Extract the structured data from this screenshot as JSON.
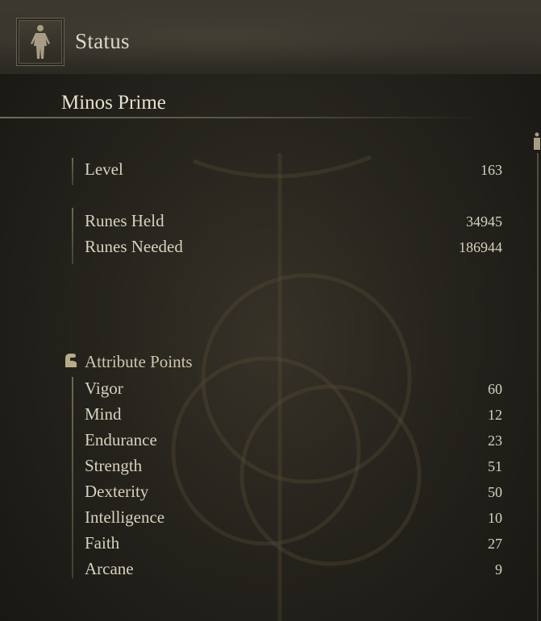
{
  "header": {
    "title": "Status",
    "portrait_icon": "character-portrait-icon"
  },
  "character": {
    "name": "Minos Prime"
  },
  "stats": [
    {
      "label": "Level",
      "value": "163"
    },
    {
      "label": "Runes Held",
      "value": "34945"
    },
    {
      "label": "Runes Needed",
      "value": "186944"
    }
  ],
  "attributes": {
    "heading": "Attribute Points",
    "heading_icon": "flexed-arm-icon",
    "items": [
      {
        "label": "Vigor",
        "value": "60"
      },
      {
        "label": "Mind",
        "value": "12"
      },
      {
        "label": "Endurance",
        "value": "23"
      },
      {
        "label": "Strength",
        "value": "51"
      },
      {
        "label": "Dexterity",
        "value": "50"
      },
      {
        "label": "Intelligence",
        "value": "10"
      },
      {
        "label": "Faith",
        "value": "27"
      },
      {
        "label": "Arcane",
        "value": "9"
      }
    ]
  },
  "colors": {
    "text": "#d8d1bf",
    "accent": "#b9ab86",
    "background": "#1f1d18"
  }
}
